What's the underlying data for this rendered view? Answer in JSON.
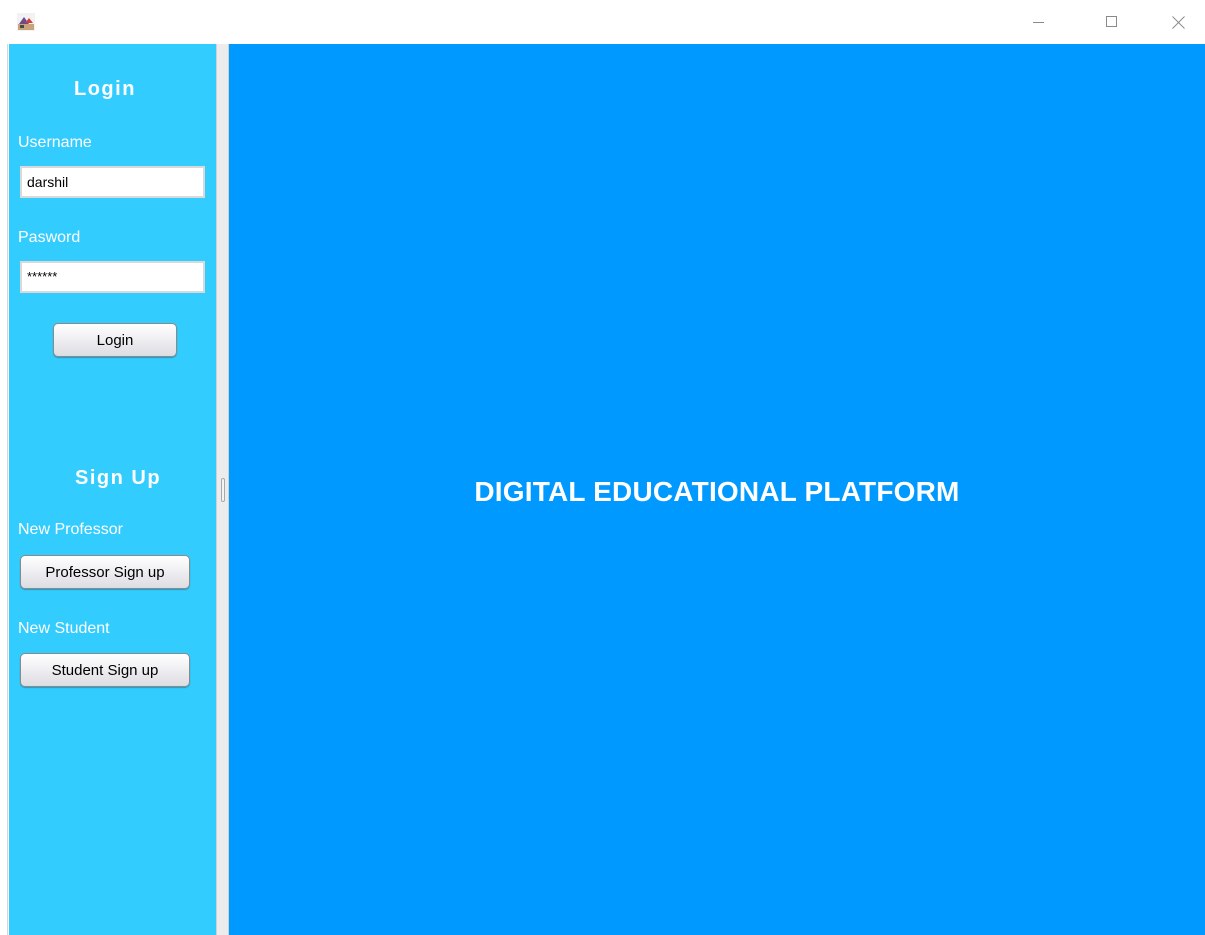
{
  "window": {
    "icon": "java-app-icon",
    "controls": {
      "minimize_icon": "minimize-icon",
      "maximize_icon": "maximize-icon",
      "close_icon": "close-icon"
    }
  },
  "sidebar": {
    "background": "#33ccff",
    "login": {
      "heading": "Login",
      "username_label": "Username",
      "username_value": "darshil",
      "password_label": "Pasword",
      "password_value": "******",
      "button_label": "Login"
    },
    "signup": {
      "heading": "Sign Up",
      "professor_label": "New Professor",
      "professor_button": "Professor Sign up",
      "student_label": "New Student",
      "student_button": "Student Sign up"
    }
  },
  "main": {
    "background": "#0099ff",
    "title": "DIGITAL EDUCATIONAL PLATFORM"
  }
}
